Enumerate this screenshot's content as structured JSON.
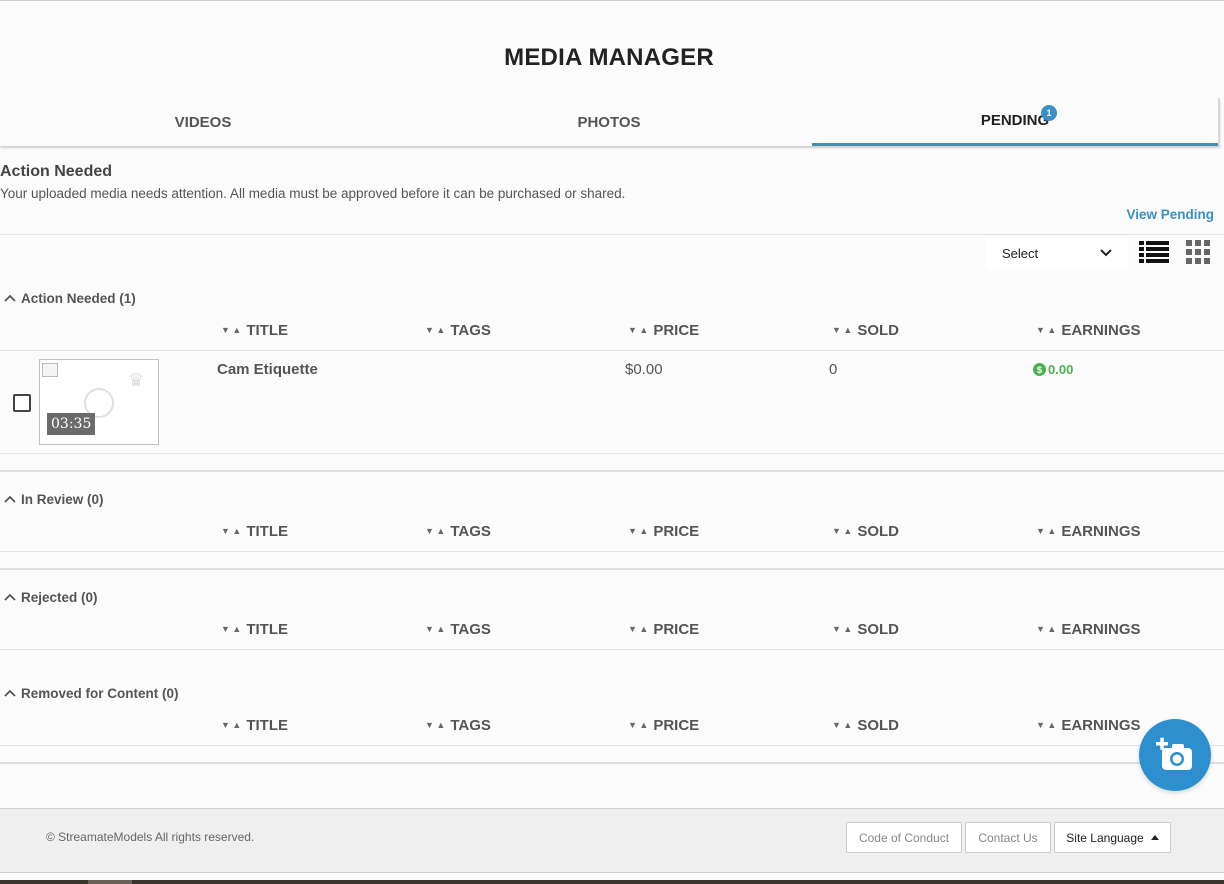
{
  "page": {
    "title": "MEDIA MANAGER"
  },
  "tabs": [
    {
      "label": "VIDEOS",
      "active": false
    },
    {
      "label": "PHOTOS",
      "active": false
    },
    {
      "label": "PENDING",
      "active": true,
      "badge": "1"
    }
  ],
  "notice": {
    "heading": "Action Needed",
    "description": "Your uploaded media needs attention. All media must be approved before it can be purchased or shared.",
    "link": "View Pending"
  },
  "toolbar": {
    "select_value": "Select",
    "list_view_icon": "list-view-icon",
    "grid_view_icon": "grid-view-icon"
  },
  "columns": [
    "TITLE",
    "TAGS",
    "PRICE",
    "SOLD",
    "EARNINGS"
  ],
  "sections": [
    {
      "title": "Action Needed (1)"
    },
    {
      "title": "In Review (0)"
    },
    {
      "title": "Rejected (0)"
    },
    {
      "title": "Removed for Content (0)"
    }
  ],
  "items": [
    {
      "title": "Cam Etiquette",
      "tags": "",
      "price": "$0.00",
      "sold": "0",
      "earnings": "0.00",
      "duration": "03:35"
    }
  ],
  "colors": {
    "accent": "#3b8fc4",
    "earnings": "#4caf50",
    "fab": "#2e8fcf"
  },
  "fab": {
    "icon": "add-photo-icon"
  },
  "footer": {
    "copyright": "© StreamateModels All rights reserved.",
    "code_of_conduct": "Code of Conduct",
    "contact_us": "Contact Us",
    "site_language": "Site Language"
  }
}
